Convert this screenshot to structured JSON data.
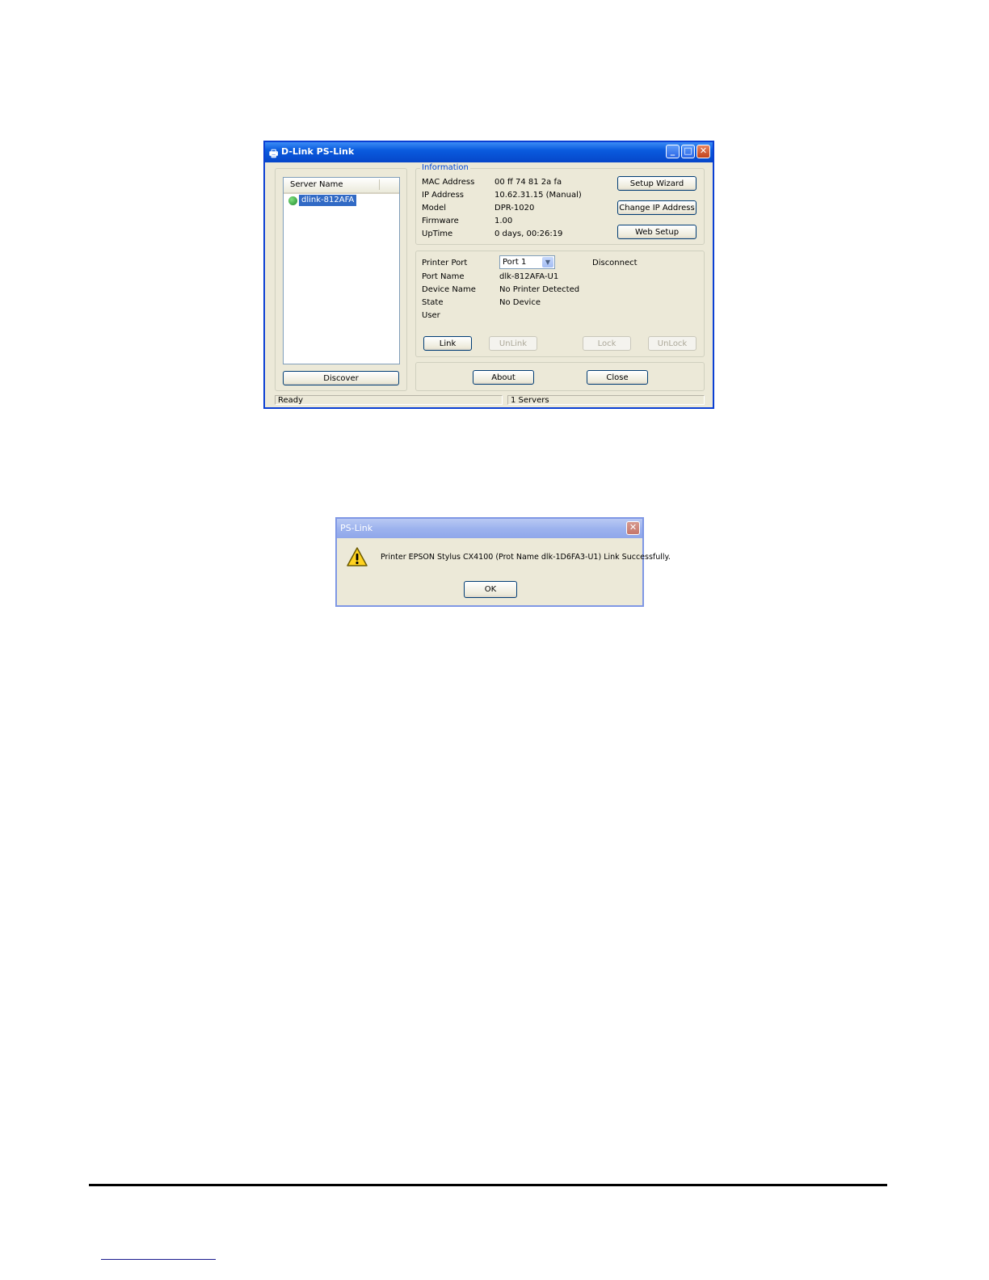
{
  "main_window": {
    "title": "D-Link PS-Link",
    "server_list": {
      "column_header": "Server Name",
      "items": [
        "dlink-812AFA"
      ],
      "discover_label": "Discover"
    },
    "information": {
      "legend": "Information",
      "rows": [
        {
          "label": "MAC Address",
          "value": "00 ff 74 81 2a fa"
        },
        {
          "label": "IP Address",
          "value": "10.62.31.15 (Manual)"
        },
        {
          "label": "Model",
          "value": "DPR-1020"
        },
        {
          "label": "Firmware",
          "value": "1.00"
        },
        {
          "label": "UpTime",
          "value": "0 days, 00:26:19"
        }
      ],
      "setup_wizard_label": "Setup Wizard",
      "change_ip_label": "Change IP Address",
      "web_setup_label": "Web Setup"
    },
    "printer": {
      "port_label": "Printer Port",
      "port_selected": "Port 1",
      "disconnect_label": "Disconnect",
      "rows": [
        {
          "label": "Port Name",
          "value": "dlk-812AFA-U1"
        },
        {
          "label": "Device Name",
          "value": "No Printer Detected"
        },
        {
          "label": "State",
          "value": "No Device"
        },
        {
          "label": "User",
          "value": ""
        }
      ],
      "link_label": "Link",
      "unlink_label": "UnLink",
      "lock_label": "Lock",
      "unlock_label": "UnLock"
    },
    "about_label": "About",
    "close_label": "Close",
    "status": {
      "left": "Ready",
      "right": "1 Servers"
    }
  },
  "dialog": {
    "title": "PS-Link",
    "message": "Printer EPSON Stylus CX4100 (Prot Name dlk-1D6FA3-U1) Link Successfully.",
    "ok_label": "OK",
    "icon": "warning-icon"
  },
  "colors": {
    "titlebar": "#0a5bde",
    "window_face": "#ece9d8",
    "selection": "#316ac5",
    "group_legend": "#0046d5"
  }
}
